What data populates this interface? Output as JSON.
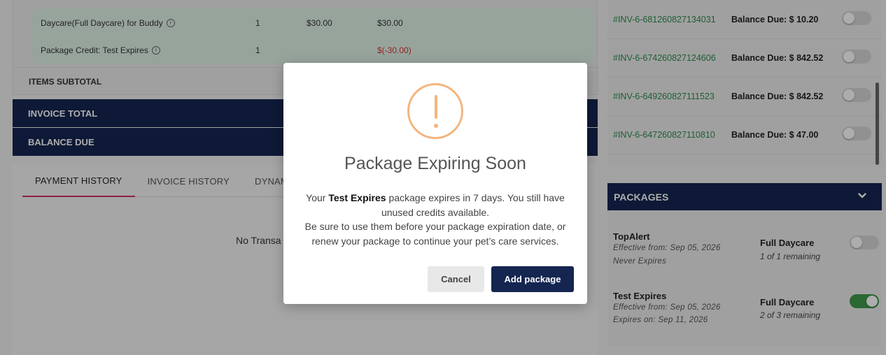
{
  "invoice_items": [
    {
      "name": "Daycare(Full Daycare) for Buddy",
      "qty": "1",
      "price": "$30.00",
      "total": "$30.00"
    },
    {
      "name": "Package Credit: Test Expires",
      "qty": "1",
      "price": "",
      "total": "$(-30.00)"
    }
  ],
  "summary": {
    "items_subtotal_label": "ITEMS SUBTOTAL",
    "invoice_total_label": "INVOICE TOTAL",
    "balance_due_label": "BALANCE DUE"
  },
  "tabs": [
    "PAYMENT HISTORY",
    "INVOICE HISTORY",
    "DYNAMIC"
  ],
  "no_transactions_text": "No Transa",
  "invoices": [
    {
      "id": "#INV-6-681260827134031",
      "balance": "Balance Due: $ 10.20"
    },
    {
      "id": "#INV-6-674260827124606",
      "balance": "Balance Due: $ 842.52"
    },
    {
      "id": "#INV-6-649260827111523",
      "balance": "Balance Due: $ 842.52"
    },
    {
      "id": "#INV-6-647260827110810",
      "balance": "Balance Due: $ 47.00"
    }
  ],
  "packages": {
    "header": "PACKAGES",
    "items": [
      {
        "name": "TopAlert",
        "effective": "Effective from: Sep 05, 2026",
        "expiry": "Never Expires",
        "type": "Full Daycare",
        "remaining": "1 of 1 remaining",
        "enabled": false
      },
      {
        "name": "Test Expires",
        "effective": "Effective from: Sep 05, 2026",
        "expiry": "Expires on: Sep 11, 2026",
        "type": "Full Daycare",
        "remaining": "2 of 3 remaining",
        "enabled": true
      }
    ]
  },
  "modal": {
    "title": "Package Expiring Soon",
    "text_prefix": "Your ",
    "package_name": "Test Expires",
    "text_suffix": " package expires in 7 days. You still have unused credits available.",
    "text_line2": "Be sure to use them before your package expiration date, or renew your package to continue your pet’s care services.",
    "cancel_label": "Cancel",
    "add_label": "Add package"
  },
  "colors": {
    "navy": "#142550",
    "invoice_id_green": "#2e8b4f",
    "warning_orange": "#f3b57e",
    "tab_active_underline": "#d2325f",
    "toggle_on": "#3d9a4a"
  },
  "icons": {
    "info": "info-icon",
    "chevron": "chevron-down-icon",
    "warning": "exclamation-circle-icon"
  }
}
